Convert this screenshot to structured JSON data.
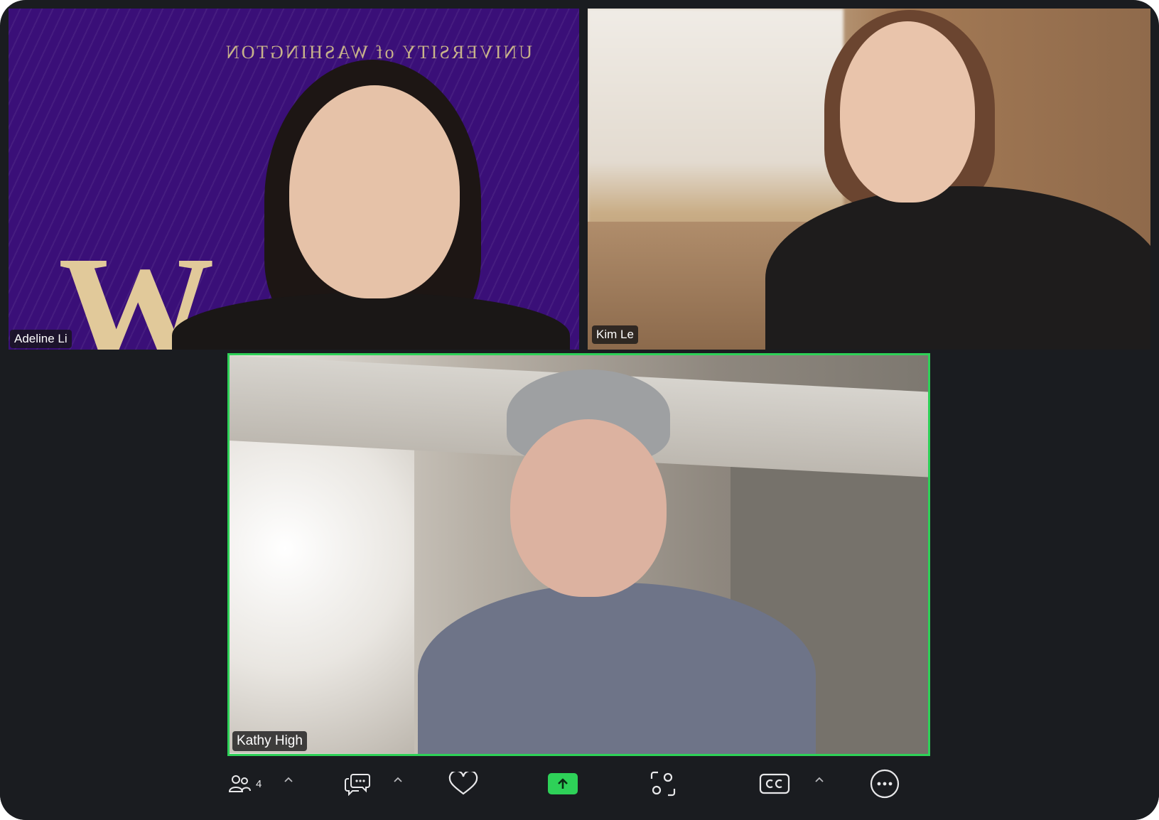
{
  "participants": [
    {
      "name": "Adeline Li"
    },
    {
      "name": "Kim Le"
    },
    {
      "name": "Kathy High"
    }
  ],
  "background": {
    "wordmark": "UNIVERSITY of WASHINGTON",
    "logo": "W"
  },
  "toolbar": {
    "participants_count": "4",
    "icons": [
      "participants-icon",
      "chat-icon",
      "reactions-icon",
      "share-screen-icon",
      "apps-icon",
      "captions-icon",
      "more-icon"
    ]
  },
  "colors": {
    "active_speaker": "#2ed158",
    "window_bg": "#1a1c20",
    "uw_purple": "#3a0f78",
    "uw_gold": "#c8b38a"
  }
}
